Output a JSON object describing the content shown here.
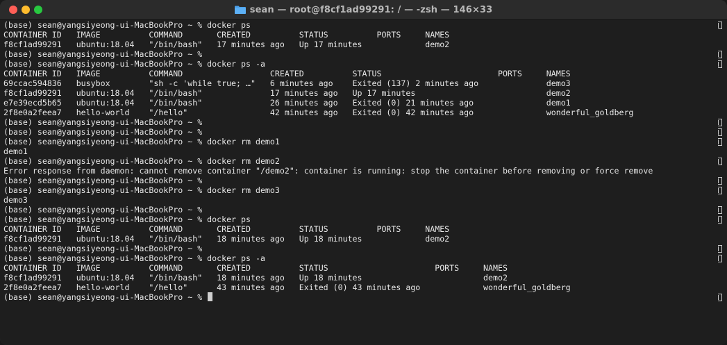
{
  "window": {
    "title": "sean — root@f8cf1ad99291: / — -zsh — 146×33",
    "title_icon": "folder-icon"
  },
  "terminal": {
    "lines": [
      "(base) sean@yangsiyeong-ui-MacBookPro ~ % docker ps",
      "CONTAINER ID   IMAGE          COMMAND       CREATED          STATUS          PORTS     NAMES",
      "f8cf1ad99291   ubuntu:18.04   \"/bin/bash\"   17 minutes ago   Up 17 minutes             demo2",
      "(base) sean@yangsiyeong-ui-MacBookPro ~ %",
      "(base) sean@yangsiyeong-ui-MacBookPro ~ % docker ps -a",
      "CONTAINER ID   IMAGE          COMMAND                  CREATED          STATUS                        PORTS     NAMES",
      "69ccac594836   busybox        \"sh -c 'while true; …\"   6 minutes ago    Exited (137) 2 minutes ago              demo3",
      "f8cf1ad99291   ubuntu:18.04   \"/bin/bash\"              17 minutes ago   Up 17 minutes                           demo2",
      "e7e39ecd5b65   ubuntu:18.04   \"/bin/bash\"              26 minutes ago   Exited (0) 21 minutes ago               demo1",
      "2f8e0a2feea7   hello-world    \"/hello\"                 42 minutes ago   Exited (0) 42 minutes ago               wonderful_goldberg",
      "(base) sean@yangsiyeong-ui-MacBookPro ~ %",
      "(base) sean@yangsiyeong-ui-MacBookPro ~ %",
      "(base) sean@yangsiyeong-ui-MacBookPro ~ % docker rm demo1",
      "demo1",
      "(base) sean@yangsiyeong-ui-MacBookPro ~ % docker rm demo2",
      "Error response from daemon: cannot remove container \"/demo2\": container is running: stop the container before removing or force remove",
      "(base) sean@yangsiyeong-ui-MacBookPro ~ %",
      "(base) sean@yangsiyeong-ui-MacBookPro ~ % docker rm demo3",
      "demo3",
      "(base) sean@yangsiyeong-ui-MacBookPro ~ %",
      "(base) sean@yangsiyeong-ui-MacBookPro ~ % docker ps",
      "CONTAINER ID   IMAGE          COMMAND       CREATED          STATUS          PORTS     NAMES",
      "f8cf1ad99291   ubuntu:18.04   \"/bin/bash\"   18 minutes ago   Up 18 minutes             demo2",
      "(base) sean@yangsiyeong-ui-MacBookPro ~ %",
      "(base) sean@yangsiyeong-ui-MacBookPro ~ % docker ps -a",
      "CONTAINER ID   IMAGE          COMMAND       CREATED          STATUS                      PORTS     NAMES",
      "f8cf1ad99291   ubuntu:18.04   \"/bin/bash\"   18 minutes ago   Up 18 minutes                         demo2",
      "2f8e0a2feea7   hello-world    \"/hello\"      43 minutes ago   Exited (0) 43 minutes ago             wonderful_goldberg",
      "(base) sean@yangsiyeong-ui-MacBookPro ~ % "
    ],
    "cursor_visible": true
  },
  "colors": {
    "background": "#1e1e1e",
    "text": "#e6e6e6",
    "titlebar": "#2b2b2b",
    "close": "#ff5f57",
    "minimize": "#febc2e",
    "maximize": "#28c840"
  }
}
